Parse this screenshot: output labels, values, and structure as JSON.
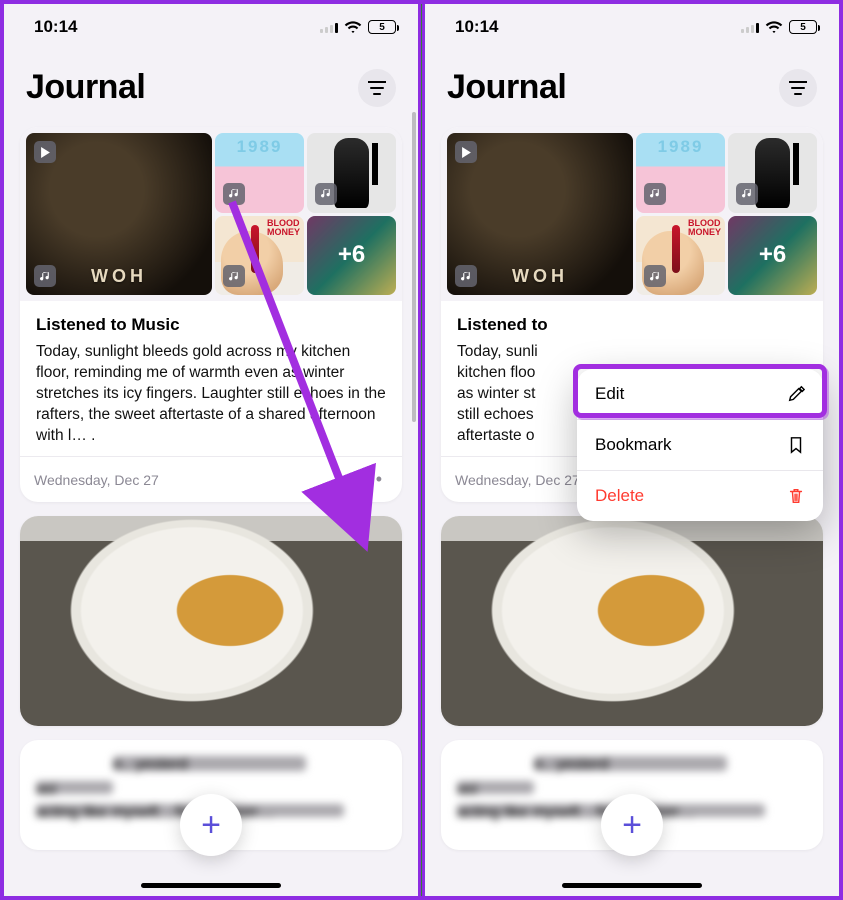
{
  "status": {
    "time": "10:14",
    "battery": "5"
  },
  "header": {
    "title": "Journal"
  },
  "entry1": {
    "tiles": {
      "big_title": "WOH",
      "ts_digits": "1989",
      "bm_label": "BLOOD\nMONEY",
      "more": "+6"
    },
    "title": "Listened to Music",
    "body_full": "Today, sunlight bleeds gold across my kitchen floor, reminding me of warmth even as winter stretches its icy fingers. Laughter still echoes in the rafters, the sweet aftertaste of a shared afternoon with l…  .",
    "body_cut": "Today, sunli\nkitchen floo\nas winter st\nstill echoes\naftertaste o",
    "title_cut": "Listened to",
    "date": "Wednesday, Dec 27"
  },
  "entry2": {
    "blurred_hint_1": "e., yesterd",
    "blurred_hint_2": "asi",
    "blurred_hint_3": "acting like myself,        , from tomorr…"
  },
  "menu": {
    "edit": "Edit",
    "bookmark": "Bookmark",
    "delete": "Delete"
  },
  "add_label": "+"
}
